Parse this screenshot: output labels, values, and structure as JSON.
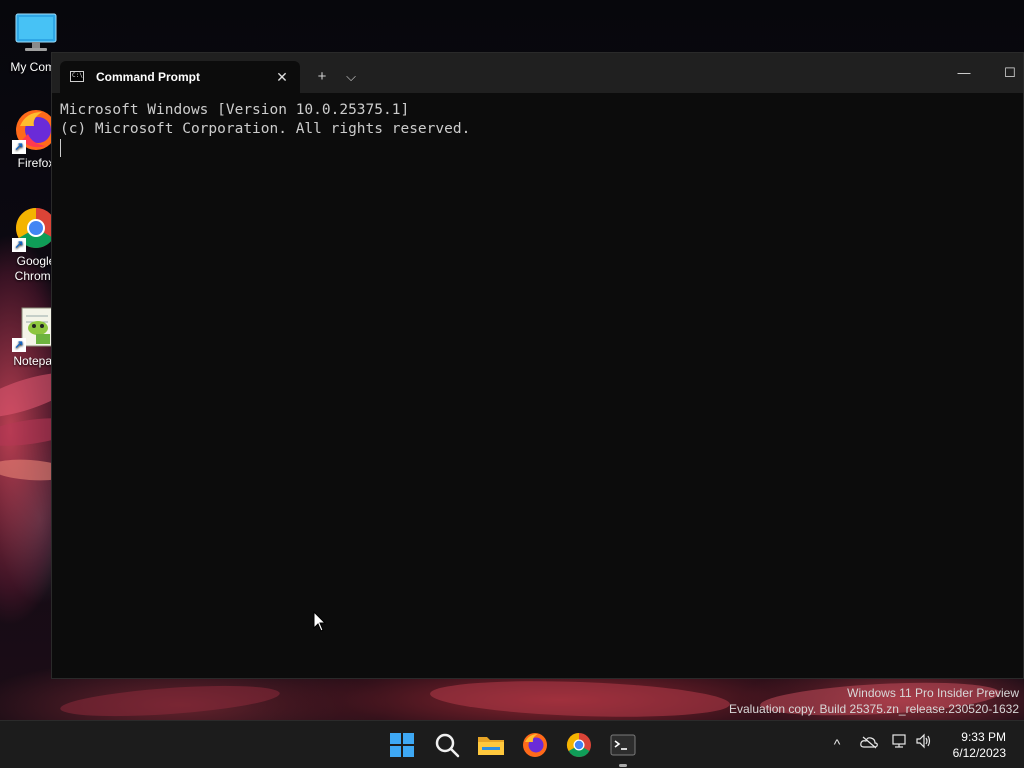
{
  "desktop": {
    "icons": [
      {
        "label": "My Comp",
        "icon": "computer-icon"
      },
      {
        "label": "Firefox",
        "icon": "firefox-icon"
      },
      {
        "label": "Google\nChrome",
        "icon": "chrome-icon"
      },
      {
        "label": "Notepad",
        "icon": "notepad-icon"
      }
    ],
    "watermark": {
      "line1": "Windows 11 Pro Insider Preview",
      "line2": "Evaluation copy. Build 25375.zn_release.230520-1632"
    }
  },
  "terminal": {
    "tab_title": "Command Prompt",
    "tab_close_glyph": "✕",
    "new_tab_glyph": "+",
    "dropdown_glyph": "⌵",
    "minimize_glyph": "—",
    "maximize_glyph": "☐",
    "lines": [
      "Microsoft Windows [Version 10.0.25375.1]",
      "(c) Microsoft Corporation. All rights reserved."
    ],
    "background_color": "#0c0c0c",
    "text_color": "#cccccc"
  },
  "taskbar": {
    "apps": [
      {
        "name": "Start",
        "icon": "windows-start-icon"
      },
      {
        "name": "Search",
        "icon": "search-icon"
      },
      {
        "name": "File Explorer",
        "icon": "folder-icon"
      },
      {
        "name": "Firefox",
        "icon": "firefox-icon"
      },
      {
        "name": "Google Chrome",
        "icon": "chrome-icon"
      },
      {
        "name": "Terminal",
        "icon": "terminal-icon",
        "running": true
      }
    ],
    "tray": {
      "chevron_glyph": "^",
      "clock_time": "9:33 PM",
      "clock_date": "6/12/2023"
    }
  }
}
